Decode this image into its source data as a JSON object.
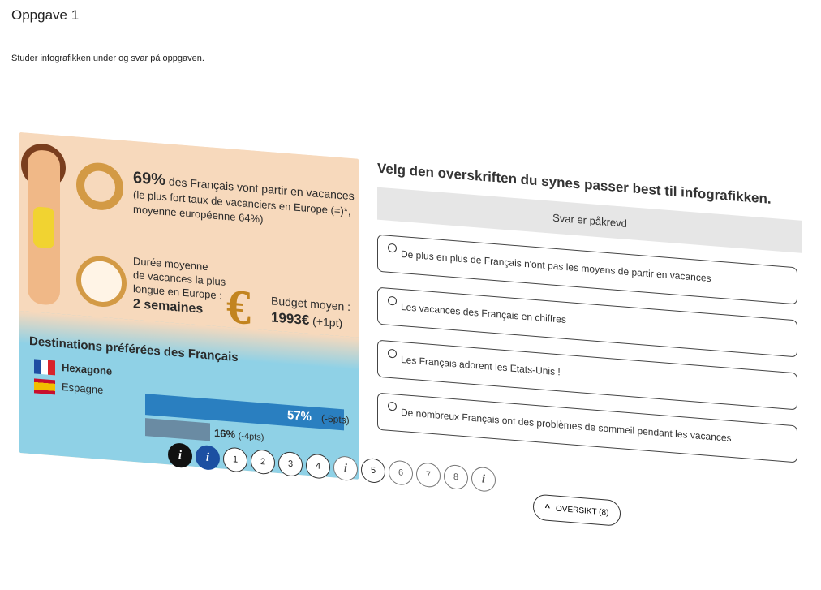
{
  "header": {
    "title": "Oppgave 1",
    "intro": "Studer infografikken under og svar på oppgaven."
  },
  "infographic": {
    "stat1_pct": "69%",
    "stat1_text": "des Français vont partir en vacances",
    "stat1_sub1": "(le plus fort taux de vacanciers en Europe (=)*,",
    "stat1_sub2": "moyenne européenne 64%)",
    "duration_label1": "Durée moyenne",
    "duration_label2": "de vacances la plus",
    "duration_label3": "longue en Europe :",
    "duration_value": "2 semaines",
    "budget_label": "Budget moyen :",
    "budget_value": "1993€",
    "budget_change": "(+1pt)",
    "dest_title": "Destinations préférées des Français",
    "dest1_name": "Hexagone",
    "dest1_pct": "57%",
    "dest1_change": "(-6pts)",
    "dest2_name": "Espagne",
    "dest2_pct": "16%",
    "dest2_change": "(-4pts)"
  },
  "question": {
    "prompt": "Velg den overskriften du synes passer best til infografikken.",
    "required": "Svar er påkrevd",
    "options": [
      "De plus en plus de Français n'ont pas les moyens de partir en vacances",
      "Les vacances des Français en chiffres",
      "Les Français adorent les Etats-Unis !",
      "De nombreux Français ont des problèmes de sommeil pendant les vacances"
    ]
  },
  "nav": {
    "items": [
      "i",
      "i",
      "1",
      "2",
      "3",
      "4",
      "i",
      "5",
      "6",
      "7",
      "8",
      "i"
    ],
    "overview_label": "OVERSIKT (8)"
  },
  "colors": {
    "accent_blue": "#1c4fa2",
    "bar_blue": "#2a7fc0",
    "orange": "#d39a45"
  }
}
